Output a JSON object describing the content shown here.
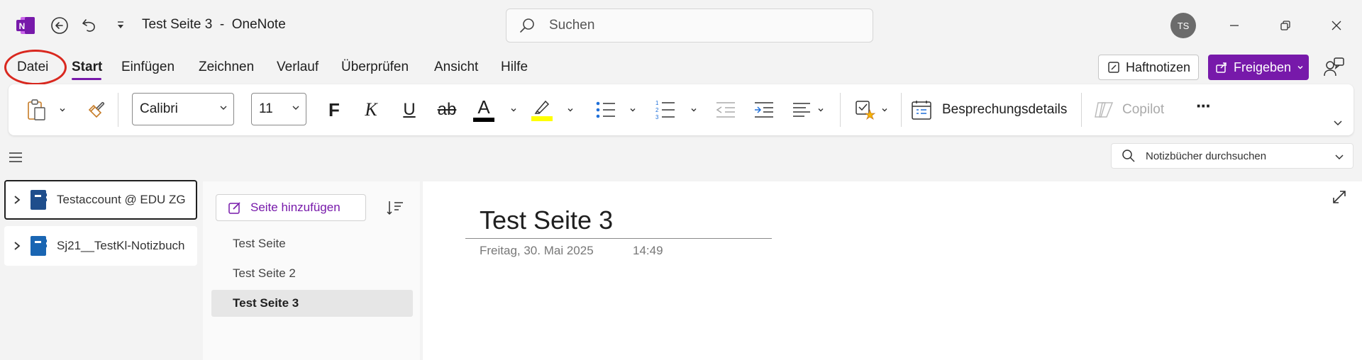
{
  "titlebar": {
    "title": "Test Seite 3  -  OneNote",
    "search_placeholder": "Suchen",
    "avatar_initials": "TS"
  },
  "menu": {
    "items": [
      "Datei",
      "Start",
      "Einfügen",
      "Zeichnen",
      "Verlauf",
      "Überprüfen",
      "Ansicht",
      "Hilfe"
    ],
    "active": "Start",
    "sticky_notes_label": "Haftnotizen",
    "share_label": "Freigeben"
  },
  "ribbon": {
    "font_name": "Calibri",
    "font_size": "11",
    "bold_label": "F",
    "italic_label": "K",
    "underline_label": "U",
    "strike_label": "ab",
    "font_color_label": "A",
    "meeting_details_label": "Besprechungsdetails",
    "copilot_label": "Copilot",
    "more_label": "···",
    "colors": {
      "font_color": "#000000",
      "highlight": "#ffff00",
      "accent": "#7719aa",
      "list_blue": "#1e6fd9"
    }
  },
  "notebooks": {
    "search_placeholder": "Notizbücher durchsuchen",
    "items": [
      {
        "label": "Testaccount @ EDU ZG",
        "selected": true,
        "icon": "notebook-icon"
      },
      {
        "label": "Sj21__TestKl-Notizbuch",
        "selected": false,
        "icon": "notebook-icon"
      }
    ]
  },
  "pages": {
    "add_page_label": "Seite hinzufügen",
    "items": [
      {
        "label": "Test Seite",
        "selected": false
      },
      {
        "label": "Test Seite 2",
        "selected": false
      },
      {
        "label": "Test Seite 3",
        "selected": true
      }
    ]
  },
  "content": {
    "title": "Test Seite 3",
    "date": "Freitag, 30. Mai 2025",
    "time": "14:49"
  }
}
